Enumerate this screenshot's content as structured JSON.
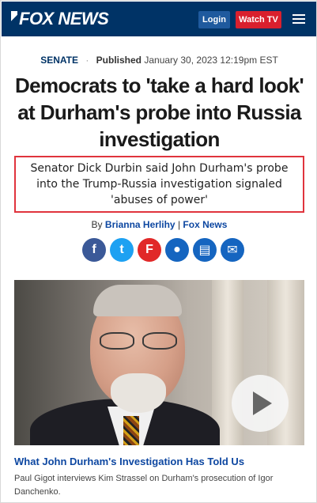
{
  "header": {
    "logo_text": "FOX NEWS",
    "login_label": "Login",
    "watch_label": "Watch TV",
    "colors": {
      "bar": "#003366",
      "login": "#1f5a9e",
      "watch": "#d9202e"
    }
  },
  "meta": {
    "section": "SENATE",
    "separator": "·",
    "published_label": "Published",
    "published_date": "January 30, 2023 12:19pm EST"
  },
  "article": {
    "headline": "Democrats to 'take a hard look' at Durham's probe into Russia investigation",
    "subhead": "Senator Dick Durbin said John Durham's probe into the Trump-Russia investigation signaled 'abuses of power'",
    "byline_prefix": "By",
    "author": "Brianna Herlihy",
    "byline_sep": "|",
    "outlet": "Fox News"
  },
  "share": [
    {
      "name": "facebook-icon",
      "glyph": "f"
    },
    {
      "name": "twitter-icon",
      "glyph": "t"
    },
    {
      "name": "flipboard-icon",
      "glyph": "F"
    },
    {
      "name": "comment-icon",
      "glyph": "●"
    },
    {
      "name": "print-icon",
      "glyph": "▤"
    },
    {
      "name": "email-icon",
      "glyph": "✉"
    }
  ],
  "video": {
    "title": "What John Durham's Investigation Has Told Us",
    "description": "Paul Gigot interviews Kim Strassel on Durham's prosecution of Igor Danchenko."
  }
}
